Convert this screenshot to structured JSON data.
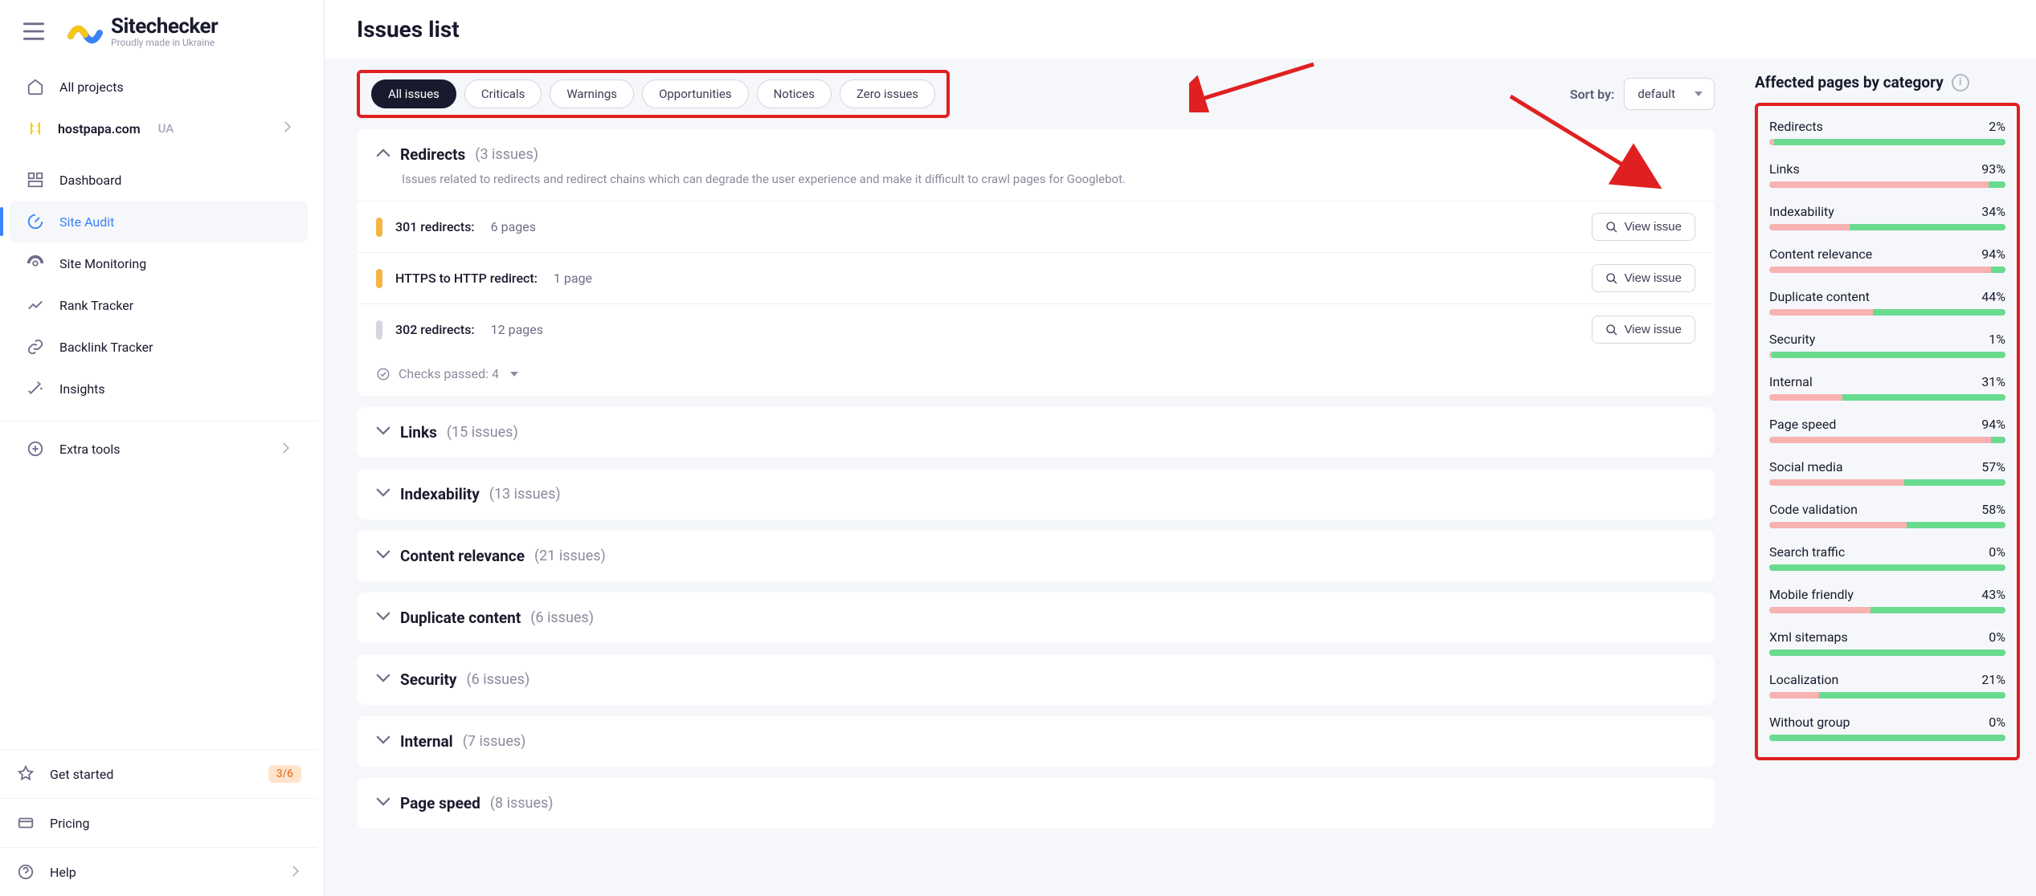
{
  "brand": {
    "name": "Sitechecker",
    "tagline": "Proudly made in Ukraine"
  },
  "sidebar": {
    "all_projects": "All projects",
    "project": {
      "name": "hostpapa.com",
      "tag": "UA"
    },
    "nav": {
      "dashboard": "Dashboard",
      "site_audit": "Site Audit",
      "site_monitoring": "Site Monitoring",
      "rank_tracker": "Rank Tracker",
      "backlink_tracker": "Backlink Tracker",
      "insights": "Insights",
      "extra_tools": "Extra tools",
      "get_started": "Get started",
      "get_started_badge": "3/6",
      "pricing": "Pricing",
      "help": "Help"
    }
  },
  "page": {
    "title": "Issues list"
  },
  "filter_pills": {
    "all": "All issues",
    "criticals": "Criticals",
    "warnings": "Warnings",
    "opportunities": "Opportunities",
    "notices": "Notices",
    "zero": "Zero issues"
  },
  "sort": {
    "label": "Sort by:",
    "value": "default"
  },
  "groups": {
    "redirects": {
      "title": "Redirects",
      "count_text": "(3 issues)",
      "desc": "Issues related to redirects and redirect chains which can degrade the user experience and make it difficult to crawl pages for Googlebot.",
      "items": [
        {
          "name": "301 redirects:",
          "pages": "6 pages",
          "sev": "orange"
        },
        {
          "name": "HTTPS to HTTP redirect:",
          "pages": "1 page",
          "sev": "orange"
        },
        {
          "name": "302 redirects:",
          "pages": "12 pages",
          "sev": "grey"
        }
      ],
      "view_label": "View issue",
      "checks_passed": "Checks passed: 4"
    },
    "collapsed": [
      {
        "title": "Links",
        "count": "(15 issues)"
      },
      {
        "title": "Indexability",
        "count": "(13 issues)"
      },
      {
        "title": "Content relevance",
        "count": "(21 issues)"
      },
      {
        "title": "Duplicate content",
        "count": "(6 issues)"
      },
      {
        "title": "Security",
        "count": "(6 issues)"
      },
      {
        "title": "Internal",
        "count": "(7 issues)"
      },
      {
        "title": "Page speed",
        "count": "(8 issues)"
      }
    ]
  },
  "right": {
    "title": "Affected pages by category",
    "categories": [
      {
        "name": "Redirects",
        "pct": 2
      },
      {
        "name": "Links",
        "pct": 93
      },
      {
        "name": "Indexability",
        "pct": 34
      },
      {
        "name": "Content relevance",
        "pct": 94
      },
      {
        "name": "Duplicate content",
        "pct": 44
      },
      {
        "name": "Security",
        "pct": 1
      },
      {
        "name": "Internal",
        "pct": 31
      },
      {
        "name": "Page speed",
        "pct": 94
      },
      {
        "name": "Social media",
        "pct": 57
      },
      {
        "name": "Code validation",
        "pct": 58
      },
      {
        "name": "Search traffic",
        "pct": 0
      },
      {
        "name": "Mobile friendly",
        "pct": 43
      },
      {
        "name": "Xml sitemaps",
        "pct": 0
      },
      {
        "name": "Localization",
        "pct": 21
      },
      {
        "name": "Without group",
        "pct": 0
      }
    ]
  }
}
